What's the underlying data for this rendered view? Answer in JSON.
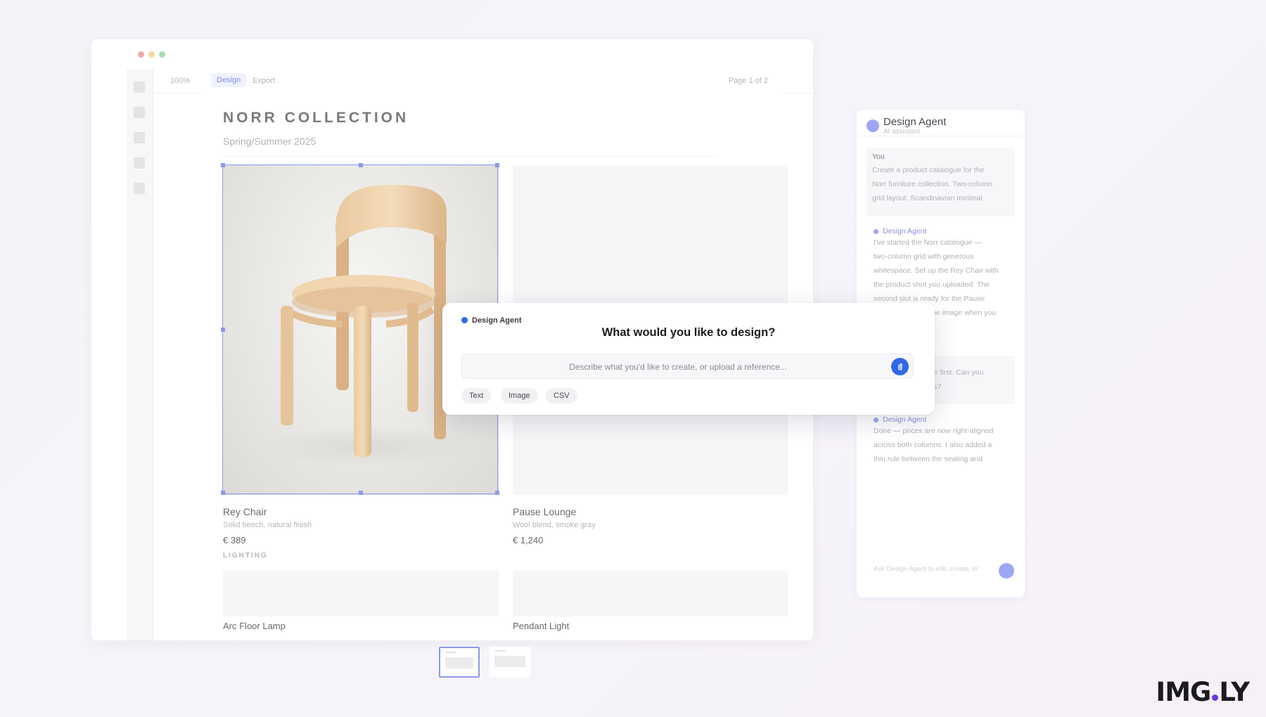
{
  "editor": {
    "toolbar": {
      "zoom": "100%",
      "tabs": [
        "Design",
        "Export"
      ],
      "active_tab": "Design",
      "page_indicator": "Page 1 of 2"
    },
    "catalogue": {
      "title": "NORR COLLECTION",
      "subtitle": "Spring/Summer 2025",
      "products": [
        {
          "name": "Rey Chair",
          "desc": "Solid beech, natural finish",
          "price": "€ 389"
        },
        {
          "name": "Pause Lounge",
          "desc": "Wool blend, smoke gray",
          "price": "€ 1,240"
        }
      ],
      "section_label": "LIGHTING",
      "lighting_items": [
        {
          "name": "Arc Floor Lamp"
        },
        {
          "name": "Pendant Light"
        }
      ]
    },
    "pages": {
      "count": 2,
      "active": 1
    }
  },
  "chat_panel": {
    "title": "Design Agent",
    "subtitle": "AI assistant",
    "messages": [
      {
        "author": "You",
        "lines": [
          "Create a product catalogue for the",
          "Norr furniture collection. Two-column",
          "grid layout. Scandinavian minimal"
        ]
      },
      {
        "author": "Design Agent",
        "lines": [
          "I've started the Norr catalogue —",
          "two-column grid with generous",
          "whitespace. Set up the Rey Chair with",
          "the product shot you uploaded. The",
          "second slot is ready for the Pause",
          "he image when you"
        ]
      },
      {
        "author": "You",
        "lines": [
          "age first. Can you",
          "ces?"
        ]
      },
      {
        "author": "Design Agent",
        "lines": [
          "Done — prices are now right-aligned",
          "across both columns. I also added a",
          "thin rule between the seating and"
        ]
      }
    ],
    "input_placeholder": "Ask Design Agent to edit, create, or"
  },
  "modal": {
    "agent_label": "Design Agent",
    "heading": "What would you like to design?",
    "prompt_placeholder": "Describe what you'd like to create, or upload a reference...",
    "chips": [
      "Text",
      "Image",
      "CSV"
    ],
    "accent_color": "#3167e8"
  },
  "brand": {
    "logo_left": "IMG",
    "logo_right": "LY",
    "dot_color": "#6a35e8"
  }
}
